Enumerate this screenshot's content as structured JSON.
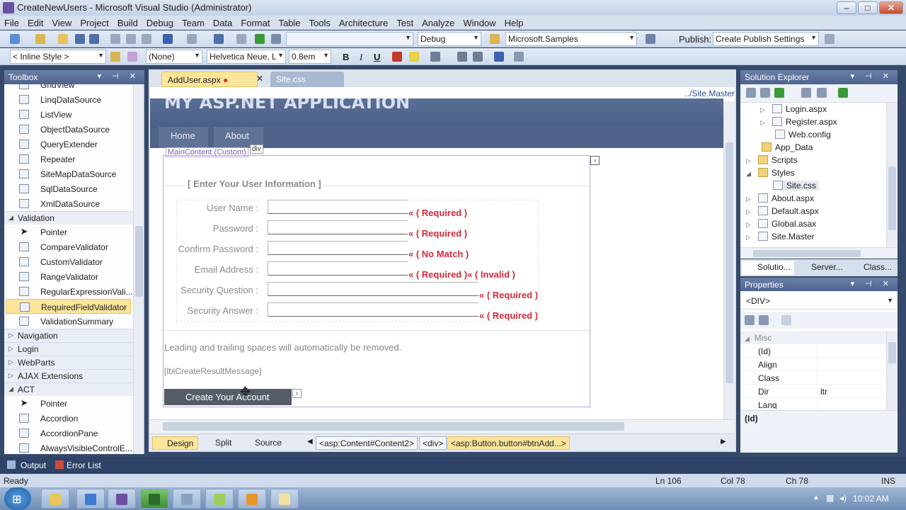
{
  "window": {
    "title": "CreateNewUsers - Microsoft Visual Studio (Administrator)",
    "min": "–",
    "max": "□",
    "close": "✕"
  },
  "menu": [
    "File",
    "Edit",
    "View",
    "Project",
    "Build",
    "Debug",
    "Team",
    "Data",
    "Format",
    "Table",
    "Tools",
    "Architecture",
    "Test",
    "Analyze",
    "Window",
    "Help"
  ],
  "toolbar1": {
    "config": "Debug",
    "project": "Microsoft.Samples",
    "publish_label": "Publish:",
    "publish_value": "Create Publish Settings"
  },
  "toolbar2": {
    "style": "< Inline Style >",
    "format": "(None)",
    "font": "Helvetica Neue, L",
    "size": "0.8em",
    "bold": "B",
    "italic": "I",
    "underline": "U"
  },
  "toolbox": {
    "title": "Toolbox",
    "items_top": [
      {
        "label": "GridView",
        "icon": "grid-icon"
      },
      {
        "label": "LinqDataSource",
        "icon": "linq-icon"
      },
      {
        "label": "ListView",
        "icon": "list-icon"
      },
      {
        "label": "ObjectDataSource",
        "icon": "object-icon"
      },
      {
        "label": "QueryExtender",
        "icon": "query-icon"
      },
      {
        "label": "Repeater",
        "icon": "repeater-icon"
      },
      {
        "label": "SiteMapDataSource",
        "icon": "sitemap-icon"
      },
      {
        "label": "SqlDataSource",
        "icon": "sql-icon"
      },
      {
        "label": "XmlDataSource",
        "icon": "xml-icon"
      }
    ],
    "validation_cat": "Validation",
    "validation_items": [
      {
        "label": "Pointer",
        "icon": "pointer-icon"
      },
      {
        "label": "CompareValidator",
        "icon": "compare-icon"
      },
      {
        "label": "CustomValidator",
        "icon": "custom-icon"
      },
      {
        "label": "RangeValidator",
        "icon": "range-icon"
      },
      {
        "label": "RegularExpressionVali...",
        "icon": "regex-icon"
      },
      {
        "label": "RequiredFieldValidator",
        "icon": "required-icon"
      },
      {
        "label": "ValidationSummary",
        "icon": "summary-icon"
      }
    ],
    "collapsed_cats": [
      "Navigation",
      "Login",
      "WebParts",
      "AJAX Extensions"
    ],
    "act_cat": "ACT",
    "act_items": [
      {
        "label": "Pointer",
        "icon": "pointer-icon"
      },
      {
        "label": "Accordion",
        "icon": "accordion-icon"
      },
      {
        "label": "AccordionPane",
        "icon": "accordion-pane-icon"
      },
      {
        "label": "AlwaysVisibleControlE...",
        "icon": "visible-icon"
      }
    ]
  },
  "tabs": {
    "active": "AddUser.aspx",
    "inactive": "Site.css"
  },
  "design": {
    "master_path": "../Site.Master",
    "app_title": "MY ASP.NET APPLICATION",
    "nav": [
      "Home",
      "About"
    ],
    "content_label": "MainContent (Custom)",
    "div_tag": "div",
    "legend": "[ Enter Your User Information ]",
    "fields": [
      {
        "label": "User Name :",
        "msg": "« ( Required )"
      },
      {
        "label": "Password :",
        "msg": "« ( Required )"
      },
      {
        "label": "Confirm Password :",
        "msg": "« ( No Match )"
      },
      {
        "label": "Email Address :",
        "msg": "« ( Required )« ( Invalid )"
      },
      {
        "label": "Security Question :",
        "msg": "« ( Required )"
      },
      {
        "label": "Security Answer :",
        "msg": "« ( Required )"
      }
    ],
    "note": "Leading and trailing spaces will automatically be removed.",
    "result_msg": "[lblCreateResultMessage]",
    "button": "Create Your Account"
  },
  "bottom": {
    "views": [
      "Design",
      "Split",
      "Source"
    ],
    "crumbs": [
      "<asp:Content#Content2>",
      "<div>",
      "<asp:Button.button#btnAdd...>"
    ]
  },
  "solution": {
    "title": "Solution Explorer",
    "items": [
      "Login.aspx",
      "Register.aspx",
      "Web.config",
      "App_Data",
      "Scripts",
      "Styles",
      "Site.css",
      "About.aspx",
      "Default.aspx",
      "Global.asax",
      "Site.Master"
    ],
    "tabs": [
      "Solutio...",
      "Server...",
      "Class..."
    ]
  },
  "properties": {
    "title": "Properties",
    "object": "<DIV>",
    "category": "Misc",
    "rows": [
      {
        "name": "(Id)",
        "value": ""
      },
      {
        "name": "Align",
        "value": ""
      },
      {
        "name": "Class",
        "value": ""
      },
      {
        "name": "Dir",
        "value": "ltr"
      },
      {
        "name": "Lang",
        "value": ""
      }
    ],
    "desc": "(Id)"
  },
  "output": {
    "output": "Output",
    "errors": "Error List"
  },
  "status": {
    "ready": "Ready",
    "ln": "Ln 106",
    "col": "Col 78",
    "ch": "Ch 78",
    "ins": "INS"
  },
  "taskbar": {
    "time": "10:02 AM"
  }
}
